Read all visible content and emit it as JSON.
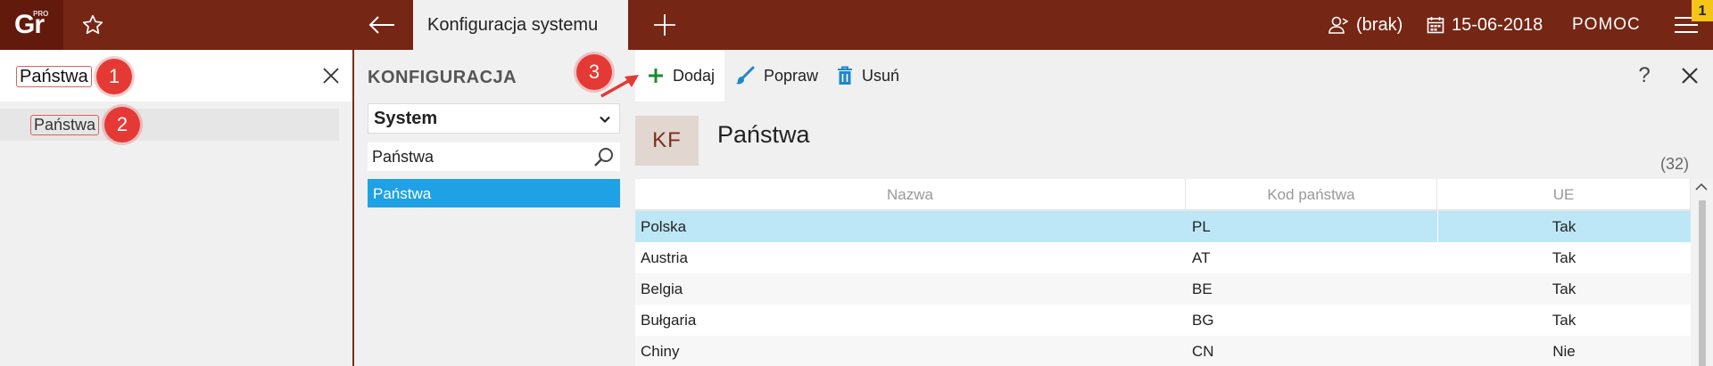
{
  "topbar": {
    "logo_text": "Gr",
    "logo_superscript": "PRO",
    "active_tab": "Konfiguracja systemu",
    "user_label": "(brak)",
    "date": "15-06-2018",
    "help_label": "POMOC",
    "notification_count": "1",
    "colors": {
      "bar": "#762614",
      "logo_bg": "#621a0d",
      "notification": "#f5c518"
    }
  },
  "left": {
    "search_value": "Państwa",
    "result_label": "Państwa",
    "markers": [
      "1",
      "2"
    ]
  },
  "middle": {
    "title": "KONFIGURACJA",
    "select_value": "System",
    "search_value": "Państwa",
    "selected_item": "Państwa",
    "accent": "#1ea2e5"
  },
  "toolbar": {
    "add_label": "Dodaj",
    "edit_label": "Popraw",
    "delete_label": "Usuń",
    "help_label": "?",
    "marker": "3"
  },
  "content": {
    "badge": "KF",
    "title": "Państwa",
    "count": "(32)"
  },
  "table": {
    "headers": [
      "Nazwa",
      "Kod państwa",
      "UE"
    ],
    "rows": [
      {
        "nazwa": "Polska",
        "kod": "PL",
        "ue": "Tak"
      },
      {
        "nazwa": "Austria",
        "kod": "AT",
        "ue": "Tak"
      },
      {
        "nazwa": "Belgia",
        "kod": "BE",
        "ue": "Tak"
      },
      {
        "nazwa": "Bułgaria",
        "kod": "BG",
        "ue": "Tak"
      },
      {
        "nazwa": "Chiny",
        "kod": "CN",
        "ue": "Nie"
      }
    ],
    "selected_row": "Polska",
    "selection_color": "#bde7f7"
  }
}
